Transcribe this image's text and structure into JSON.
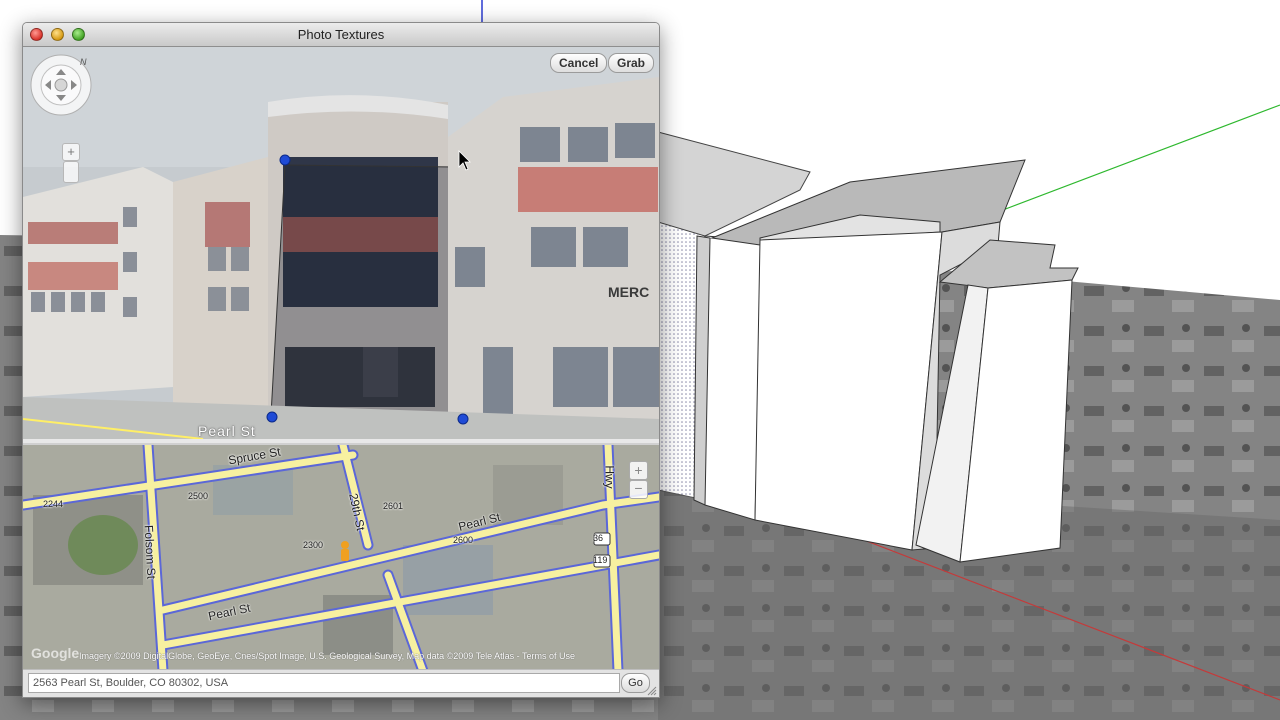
{
  "window": {
    "title": "Photo Textures"
  },
  "streetview": {
    "cancel_label": "Cancel",
    "grab_label": "Grab",
    "street_label": "Pearl St",
    "zoom_plus": "+"
  },
  "map": {
    "streets": [
      "Spruce St",
      "Folsom St",
      "Pearl St",
      "Pearl St",
      "29th St",
      "Hwy"
    ],
    "block_numbers": [
      "2500",
      "2244",
      "2601",
      "2600",
      "2300"
    ],
    "route_shields": [
      "36",
      "119"
    ],
    "zoom_plus": "+",
    "zoom_minus": "−",
    "logo": "Google",
    "copyright": "Imagery ©2009 DigitalGlobe, GeoEye, Cnes/Spot Image, U.S. Geological Survey, Map data ©2009 Tele Atlas - Terms of Use"
  },
  "address": {
    "value": "2563 Pearl St, Boulder, CO 80302, USA",
    "go_label": "Go"
  },
  "icons": {
    "nav": "compass-pan-icon",
    "north": "N",
    "pin": "pegman-icon"
  },
  "colors": {
    "road_outline": "#5b67d8",
    "road_fill": "#f7f0a0",
    "axis_green": "#2eb82e",
    "axis_red": "#c43a3a",
    "axis_blue": "#2a3bd0",
    "crop_handle": "#1f4bd6"
  }
}
